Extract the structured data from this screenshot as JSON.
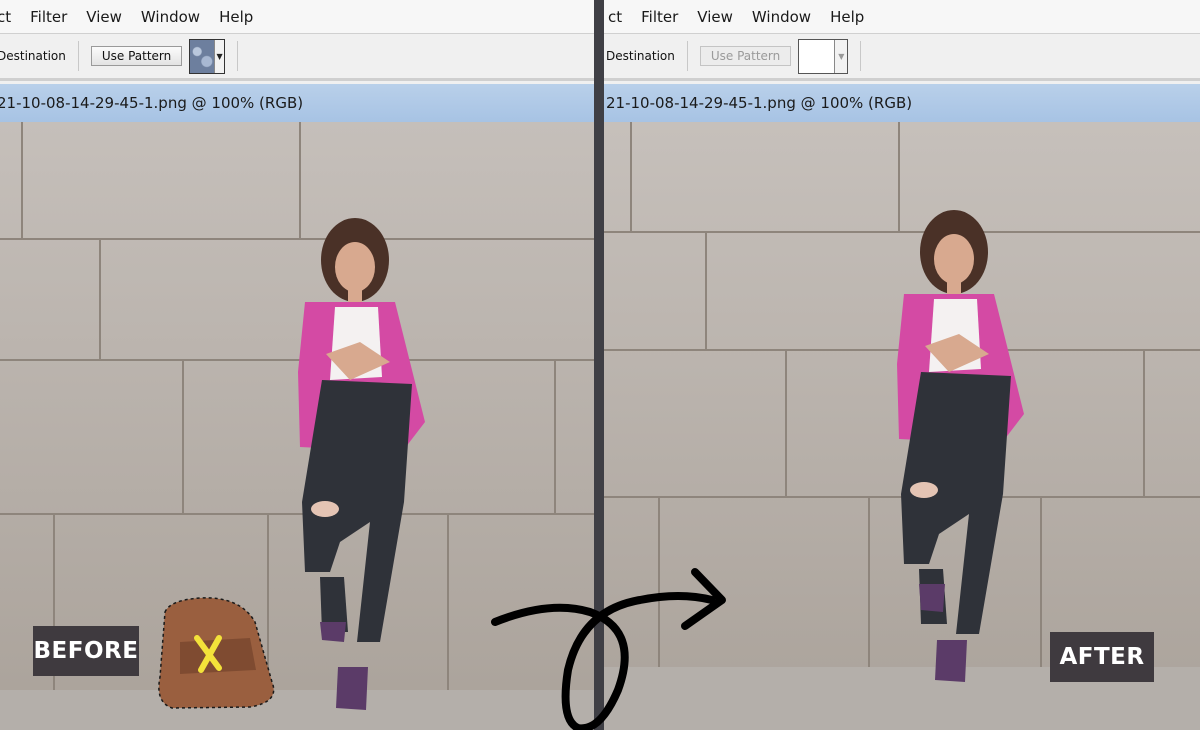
{
  "menu_left": [
    "ct",
    "Filter",
    "View",
    "Window",
    "Help"
  ],
  "menu_right": [
    "ct",
    "Filter",
    "View",
    "Window",
    "Help"
  ],
  "options_left": {
    "destination": "Destination",
    "use_pattern": "Use Pattern"
  },
  "options_right": {
    "destination": "Destination",
    "use_pattern": "Use Pattern"
  },
  "doc_title_left": "21-10-08-14-29-45-1.png @ 100% (RGB)",
  "doc_title_right": "21-10-08-14-29-45-1.png @ 100% (RGB)",
  "labels": {
    "before": "BEFORE",
    "after": "AFTER"
  },
  "colors": {
    "title_bar": "#b3cbe7",
    "label_bg": "#3f3a3f",
    "x_mark": "#f3e23a",
    "divider": "#3f3f45"
  },
  "icons": {
    "pattern_swatch": "pattern-swatch-icon",
    "dropdown": "chevron-down-icon",
    "arrow": "curved-arrow-icon",
    "x_mark": "x-mark-icon"
  }
}
